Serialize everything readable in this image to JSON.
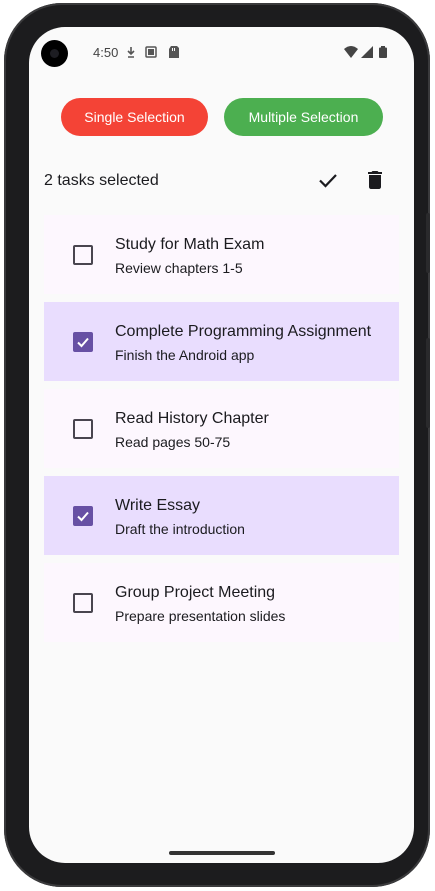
{
  "statusbar": {
    "time": "4:50"
  },
  "modes": {
    "single_label": "Single Selection",
    "multiple_label": "Multiple Selection"
  },
  "selection": {
    "count_text": "2 tasks selected"
  },
  "tasks": [
    {
      "title": "Study for Math Exam",
      "description": "Review chapters 1-5",
      "checked": false
    },
    {
      "title": "Complete Programming Assignment",
      "description": "Finish the Android app",
      "checked": true
    },
    {
      "title": "Read History Chapter",
      "description": "Read pages 50-75",
      "checked": false
    },
    {
      "title": "Write Essay",
      "description": "Draft the introduction",
      "checked": true
    },
    {
      "title": "Group Project Meeting",
      "description": "Prepare presentation slides",
      "checked": false
    }
  ],
  "icons": {
    "confirm": "check-icon",
    "delete": "trash-icon"
  },
  "colors": {
    "single_button": "#f44336",
    "multiple_button": "#4caf50",
    "selected_row": "#e9ddfe",
    "checkbox_checked": "#6750a4"
  }
}
